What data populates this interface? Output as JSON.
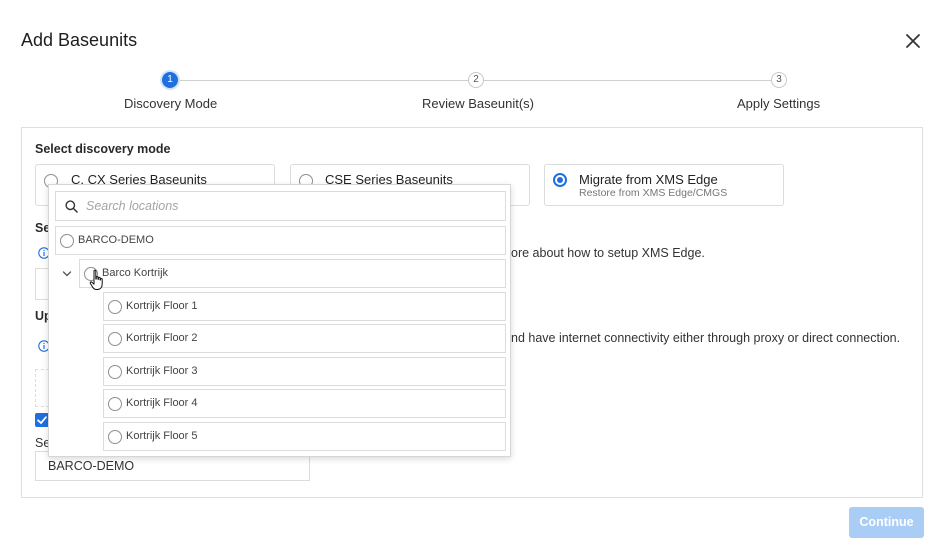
{
  "dialog": {
    "title": "Add Baseunits"
  },
  "stepper": {
    "steps": [
      {
        "number": "1",
        "label": "Discovery Mode"
      },
      {
        "number": "2",
        "label": "Review Baseunit(s)"
      },
      {
        "number": "3",
        "label": "Apply Settings"
      }
    ]
  },
  "discovery": {
    "section_label": "Select discovery mode",
    "options": [
      {
        "title": "C, CX Series Baseunits",
        "selected": false
      },
      {
        "title": "CSE Series Baseunits",
        "selected": false
      },
      {
        "title": "Migrate from XMS Edge",
        "subtitle": "Restore from XMS Edge/CMGS",
        "selected": true
      }
    ]
  },
  "background": {
    "section2_label_partial": "Se",
    "info1_text_partial": "ore about how to setup XMS Edge.",
    "section3_label_partial": "Up",
    "info2_text_partial": "nd have internet connectivity either through proxy or direct connection.",
    "site_label_partial": "Se",
    "site_value": "BARCO-DEMO"
  },
  "locations_dropdown": {
    "search_placeholder": "Search locations",
    "items": [
      {
        "label": "BARCO-DEMO",
        "level": 0
      },
      {
        "label": "Barco Kortrijk",
        "level": 1,
        "expanded": true
      },
      {
        "label": "Kortrijk Floor 1",
        "level": 2
      },
      {
        "label": "Kortrijk Floor 2",
        "level": 2
      },
      {
        "label": "Kortrijk Floor 3",
        "level": 2
      },
      {
        "label": "Kortrijk Floor 4",
        "level": 2
      },
      {
        "label": "Kortrijk Floor 5",
        "level": 2
      }
    ]
  },
  "footer": {
    "continue_label": "Continue",
    "continue_enabled": false
  },
  "colors": {
    "accent": "#1f6fe0",
    "disabled_button": "#a9cdf5",
    "border": "#dcdcdc"
  }
}
